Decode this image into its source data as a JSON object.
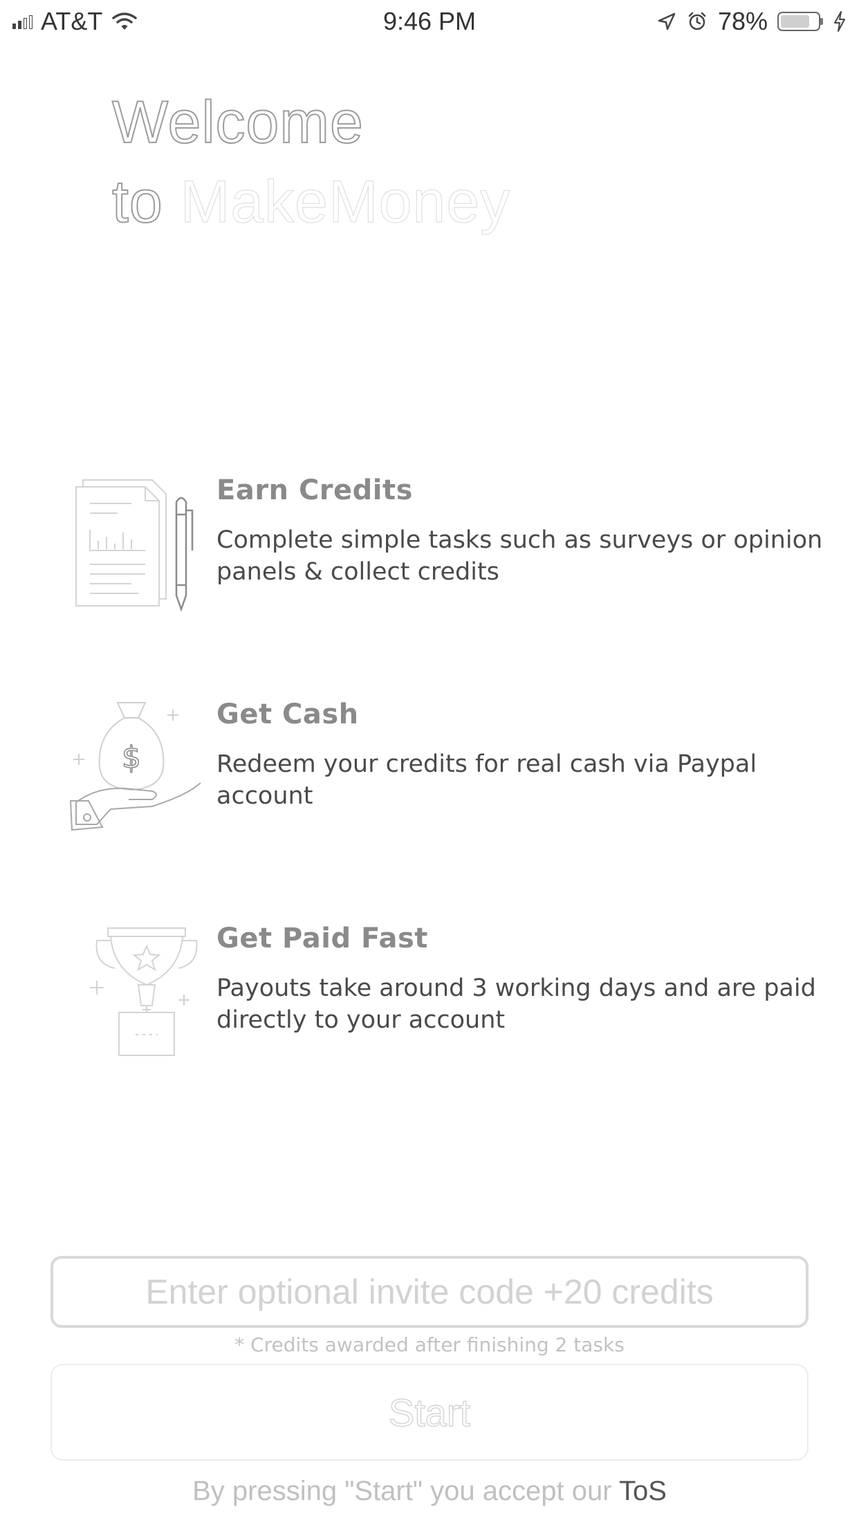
{
  "status_bar": {
    "carrier": "AT&T",
    "time": "9:46 PM",
    "battery": "78%",
    "battery_level": 0.78,
    "icons": [
      "signal-icon",
      "wifi-icon",
      "location-icon",
      "alarm-icon",
      "battery-icon",
      "charging-icon"
    ]
  },
  "welcome": {
    "line1": "Welcome",
    "line2_prefix": "to",
    "brand": "MakeMoney"
  },
  "features": [
    {
      "icon": "document-chart-pen-icon",
      "title": "Earn Credits",
      "description": "Complete simple tasks such as surveys or opinion panels & collect credits"
    },
    {
      "icon": "money-bag-hand-icon",
      "title": "Get Cash",
      "description": "Redeem your credits for real cash via Paypal account"
    },
    {
      "icon": "trophy-icon",
      "title": "Get Paid Fast",
      "description": "Payouts take around 3 working days and are paid directly to your account"
    }
  ],
  "invite": {
    "placeholder": "Enter optional invite code +20 credits",
    "value": "",
    "note": "* Credits awarded after finishing 2 tasks"
  },
  "start_button": {
    "label": "Start"
  },
  "tos": {
    "prefix": "By pressing \"Start\" you accept our ",
    "link": "ToS"
  },
  "colors": {
    "background": "#ffffff",
    "title_gray": "#8a8a8a",
    "body_text": "#4a4a4a",
    "placeholder": "#d2d2d2",
    "border": "#d9d9d9"
  }
}
